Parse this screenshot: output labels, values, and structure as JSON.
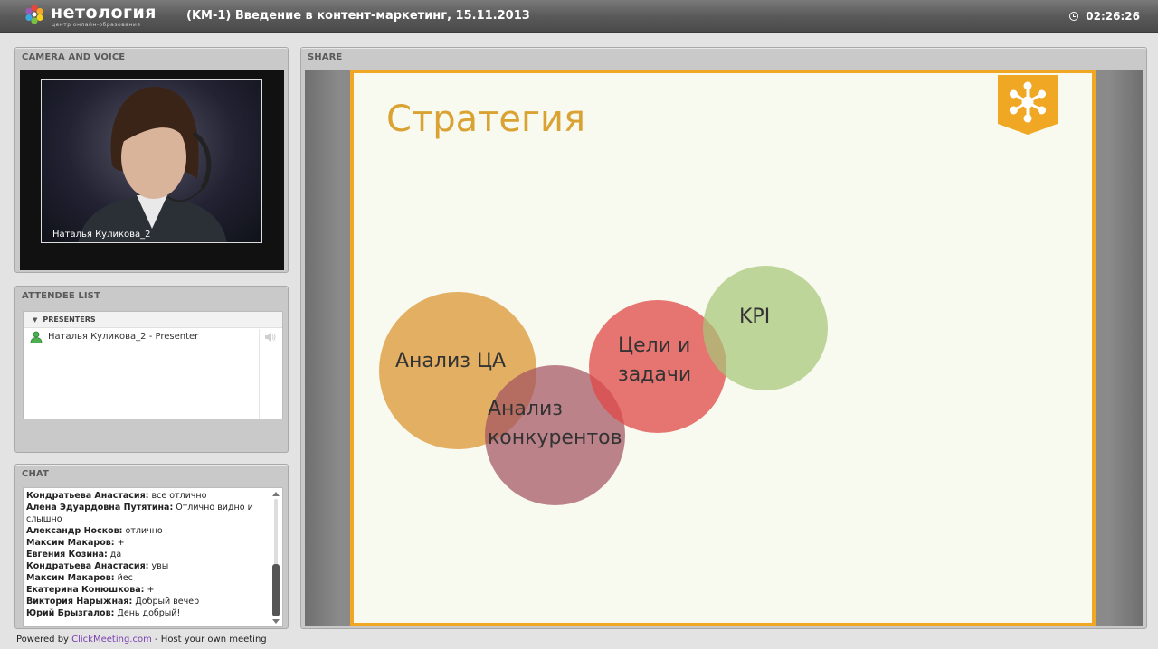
{
  "header": {
    "logo_text": "нетология",
    "logo_subtitle": "центр онлайн-образования",
    "session_title": "(KM-1) Введение в контент-маркетинг, 15.11.2013",
    "clock": "02:26:26"
  },
  "camera": {
    "header": "CAMERA AND VOICE",
    "presenter_name": "Наталья Куликова_2"
  },
  "attendees": {
    "header": "ATTENDEE LIST",
    "group_label": "PRESENTERS",
    "rows": [
      {
        "name": "Наталья Куликова_2 - Presenter"
      }
    ]
  },
  "chat": {
    "header": "CHAT",
    "messages": [
      {
        "author": "Кондратьева Анастасия:",
        "text": " все отлично"
      },
      {
        "author": "Алена Эдуардовна Путятина:",
        "text": " Отлично видно и слышно"
      },
      {
        "author": "Александр Носков:",
        "text": " отлично"
      },
      {
        "author": "Максим Макаров:",
        "text": " +"
      },
      {
        "author": "Евгения Козина:",
        "text": " да"
      },
      {
        "author": "Кондратьева Анастасия:",
        "text": " увы"
      },
      {
        "author": "Максим Макаров:",
        "text": " йес"
      },
      {
        "author": "Екатерина Конюшкова:",
        "text": " +"
      },
      {
        "author": "Виктория Нарыжная:",
        "text": " Добрый вечер"
      },
      {
        "author": "Юрий Брызгалов:",
        "text": " День добрый!"
      }
    ]
  },
  "share": {
    "header": "SHARE",
    "slide": {
      "title": "Стратегия",
      "circles": [
        {
          "label": "Анализ ЦА"
        },
        {
          "label": "Анализ\nконкурентов"
        },
        {
          "label": "Цели и\nзадачи"
        },
        {
          "label": "KPI"
        }
      ]
    }
  },
  "footer": {
    "powered_prefix": "Powered by ",
    "powered_link": "ClickMeeting.com",
    "powered_suffix": " - Host your own meeting"
  },
  "colors": {
    "accent_orange": "#f0a824",
    "title_gold": "#d9a233",
    "circle_ca": "#dd9c3e",
    "circle_competitors": "#a45361",
    "circle_goals": "#e04848",
    "circle_kpi": "#a5c676",
    "link_purple": "#7a3fb0"
  },
  "icons": [
    "flower-logo-icon",
    "clock-icon",
    "user-icon",
    "speaker-icon",
    "snowflake-badge-icon"
  ]
}
